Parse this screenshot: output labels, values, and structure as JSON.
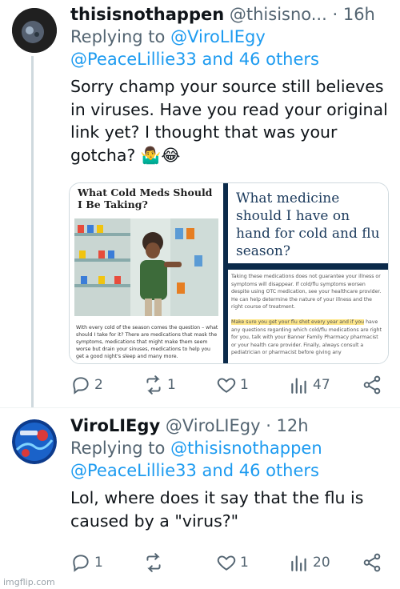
{
  "tweet1": {
    "name": "thisisnothappen",
    "handle": "@thisisno...",
    "time": "· 16h",
    "reply_label": "Replying to",
    "reply_primary": "@ViroLIEgy",
    "reply_secondary": "@PeaceLillie33 and 46 others",
    "text": "Sorry champ your source still believes in viruses. Have you read your original link yet? I thought that was your gotcha? 🤷‍♂️😂",
    "media": {
      "left_title": "What Cold Meds Should I Be Taking?",
      "left_caption": "With every cold of the season comes the question – what should I take for it? There are medications that mask the symptoms, medications that might make them seem worse but drain your sinuses, medications to help you get a good night's sleep and many more.",
      "right_title": "What medicine should I have on hand for cold and flu season?",
      "right_text_1": "Taking these medications does not guarantee your illness or symptoms will disappear. If cold/flu symptoms worsen despite using OTC medication, see your healthcare provider. He can help determine the nature of your illness and the right course of treatment.",
      "right_highlight": "Make sure you get your flu shot every year and if you",
      "right_text_2": "have any questions regarding which cold/flu medications are right for you, talk with your Banner Family Pharmacy pharmacist or your health care provider. Finally, always consult a pediatrician or pharmacist before giving any"
    },
    "stats": {
      "replies": "2",
      "retweets": "1",
      "likes": "1",
      "views": "47"
    }
  },
  "tweet2": {
    "name": "ViroLIEgy",
    "handle": "@ViroLIEgy",
    "time": "· 12h",
    "reply_label": "Replying to",
    "reply_primary": "@thisisnothappen",
    "reply_secondary": "@PeaceLillie33 and 46 others",
    "text": "Lol, where does it say that the flu is caused by a \"virus?\"",
    "stats": {
      "replies": "1",
      "retweets": "",
      "likes": "1",
      "views": "20"
    }
  },
  "watermark": "imgflip.com",
  "colors": {
    "link": "#1d9bf0",
    "muted": "#536471",
    "text": "#0f1419"
  }
}
